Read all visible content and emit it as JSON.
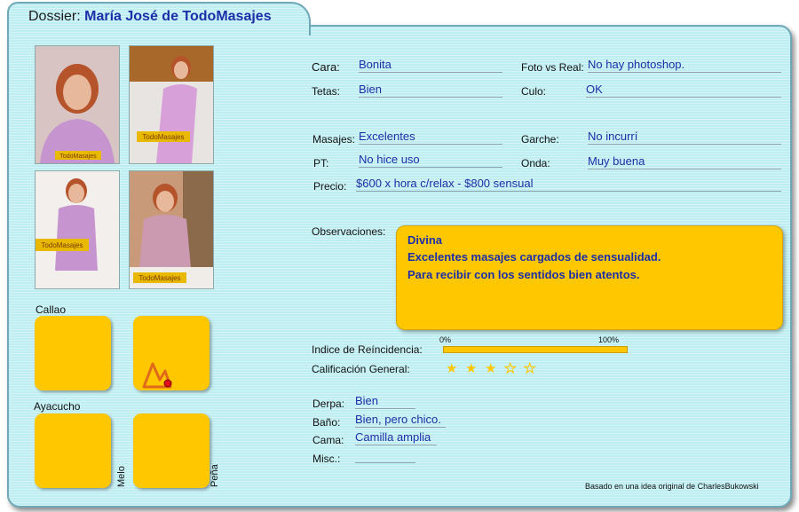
{
  "header": {
    "prefix": "Dossier:",
    "name": "María José de TodoMasajes"
  },
  "photos": [
    {
      "alt": "photo-1"
    },
    {
      "alt": "photo-2"
    },
    {
      "alt": "photo-3"
    },
    {
      "alt": "photo-4"
    }
  ],
  "logo_text": "TodoMasajes",
  "locations": {
    "callao": "Callao",
    "ayacucho": "Ayacucho",
    "melo": "Melo",
    "pena": "Peña"
  },
  "fields": {
    "cara": {
      "label": "Cara:",
      "value": "Bonita"
    },
    "foto": {
      "label": "Foto vs Real:",
      "value": "No hay photoshop."
    },
    "tetas": {
      "label": "Tetas:",
      "value": "Bien"
    },
    "culo": {
      "label": "Culo:",
      "value": "OK"
    },
    "masajes": {
      "label": "Masajes:",
      "value": "Excelentes"
    },
    "garche": {
      "label": "Garche:",
      "value": "No incurrí"
    },
    "pt": {
      "label": "PT:",
      "value": "No hice uso"
    },
    "onda": {
      "label": "Onda:",
      "value": "Muy buena"
    },
    "precio": {
      "label": "Precio:",
      "value": "$600 x hora c/relax - $800 sensual"
    }
  },
  "observaciones": {
    "label": "Observaciones:",
    "lines": [
      "Divina",
      "Excelentes masajes cargados de sensualidad.",
      "Para recibir con los sentidos bien atentos."
    ]
  },
  "reincidencia": {
    "label": "Indice de Reíncidencia:",
    "min_label": "0%",
    "max_label": "100%",
    "value_percent": 100
  },
  "calificacion": {
    "label": "Calificación General:",
    "stars_filled": 3,
    "stars_total": 5
  },
  "lugar": {
    "derpa": {
      "label": "Derpa:",
      "value": "Bien"
    },
    "bano": {
      "label": "Baño:",
      "value": "Bien, pero chico."
    },
    "cama": {
      "label": "Cama:",
      "value": "Camilla amplia"
    },
    "misc": {
      "label": "Misc.:",
      "value": ""
    }
  },
  "footer": "Basado en una idea original de CharlesBukowski",
  "colors": {
    "accent": "#fec700",
    "value_text": "#1c2fa8",
    "background": "#bfeef2"
  }
}
